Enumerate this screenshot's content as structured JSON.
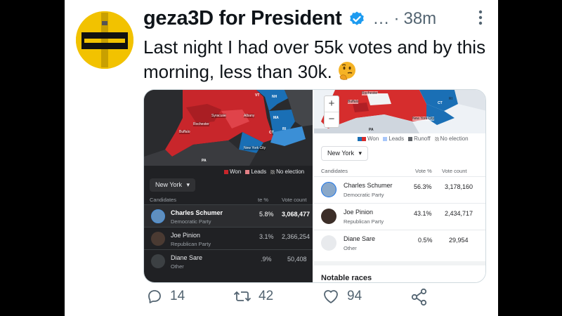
{
  "tweet": {
    "display_name": "geza3D for President",
    "more_ellipsis": "…",
    "separator": "·",
    "time": "38m",
    "text": "Last night I had over 55k votes and by this morning, less than 30k."
  },
  "dark_panel": {
    "map_labels": [
      "VT",
      "NH",
      "Syracuse",
      "Albany",
      "MA",
      "Rochester",
      "Buffalo",
      "CT",
      "RI",
      "New York City",
      "PA"
    ],
    "legend": {
      "won": "Won",
      "leads": "Leads",
      "no_election": "No election"
    },
    "state_select": "New York",
    "columns": {
      "candidates": "Candidates",
      "vote_pct": "te %",
      "vote_count": "Vote count"
    },
    "candidates": [
      {
        "name": "Charles Schumer",
        "party": "Democratic Party",
        "pct": "5.8%",
        "votes": "3,068,477"
      },
      {
        "name": "Joe Pinion",
        "party": "Republican Party",
        "pct": "3.1%",
        "votes": "2,366,254"
      },
      {
        "name": "Diane Sare",
        "party": "Other",
        "pct": ".9%",
        "votes": "50,408"
      }
    ]
  },
  "light_panel": {
    "zoom_in": "+",
    "zoom_out": "−",
    "map_labels": [
      "Rochester",
      "Buffalo",
      "CT",
      "RI",
      "New York City",
      "PA"
    ],
    "legend": {
      "won": "Won",
      "leads": "Leads",
      "runoff": "Runoff",
      "no_election": "No election"
    },
    "state_select": "New York",
    "columns": {
      "candidates": "Candidates",
      "vote_pct": "Vote %",
      "vote_count": "Vote count"
    },
    "candidates": [
      {
        "name": "Charles Schumer",
        "party": "Democratic Party",
        "pct": "56.3%",
        "votes": "3,178,160"
      },
      {
        "name": "Joe Pinion",
        "party": "Republican Party",
        "pct": "43.1%",
        "votes": "2,434,717"
      },
      {
        "name": "Diane Sare",
        "party": "Other",
        "pct": "0.5%",
        "votes": "29,954"
      }
    ],
    "notable": "Notable races"
  },
  "actions": {
    "replies": "14",
    "retweets": "42",
    "likes": "94"
  },
  "colors": {
    "republican": "#d62d2d",
    "democrat": "#1a6fb5",
    "verified": "#1d9bf0",
    "avatar_yellow": "#f2c200"
  }
}
